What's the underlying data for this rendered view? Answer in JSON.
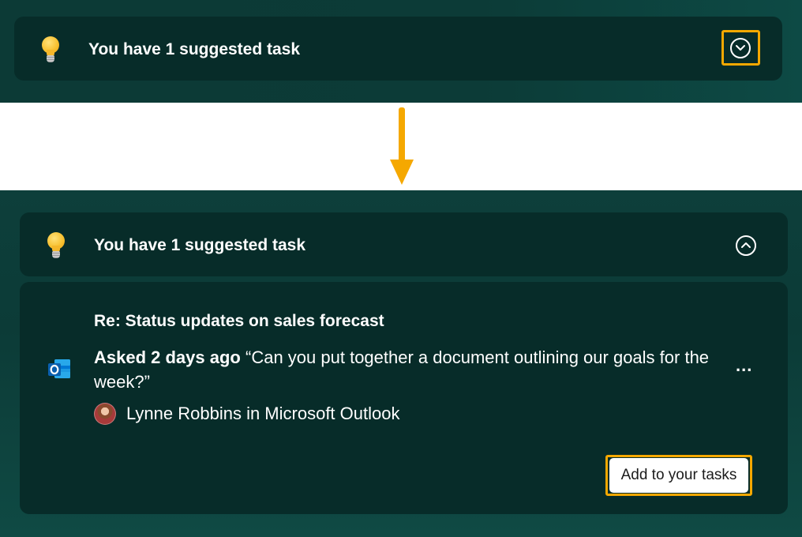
{
  "top_card": {
    "title": "You have 1 suggested task",
    "bulb_icon": "lightbulb-icon",
    "toggle_icon": "chevron-down-circle-icon"
  },
  "expanded_card": {
    "title": "You have 1 suggested task",
    "bulb_icon": "lightbulb-icon",
    "toggle_icon": "chevron-up-circle-icon"
  },
  "task": {
    "app_icon": "outlook-icon",
    "subject": "Re: Status updates on sales forecast",
    "asked": "Asked 2 days ago",
    "quote": "“Can you put together a document outlining our goals for the week?”",
    "source": "Lynne Robbins in Microsoft Outlook",
    "more_label": "...",
    "add_button": "Add to your tasks"
  },
  "colors": {
    "highlight": "#f5a800",
    "card_bg": "#072c29",
    "panel_bg": "#0c3b37",
    "arrow": "#f5a800"
  }
}
